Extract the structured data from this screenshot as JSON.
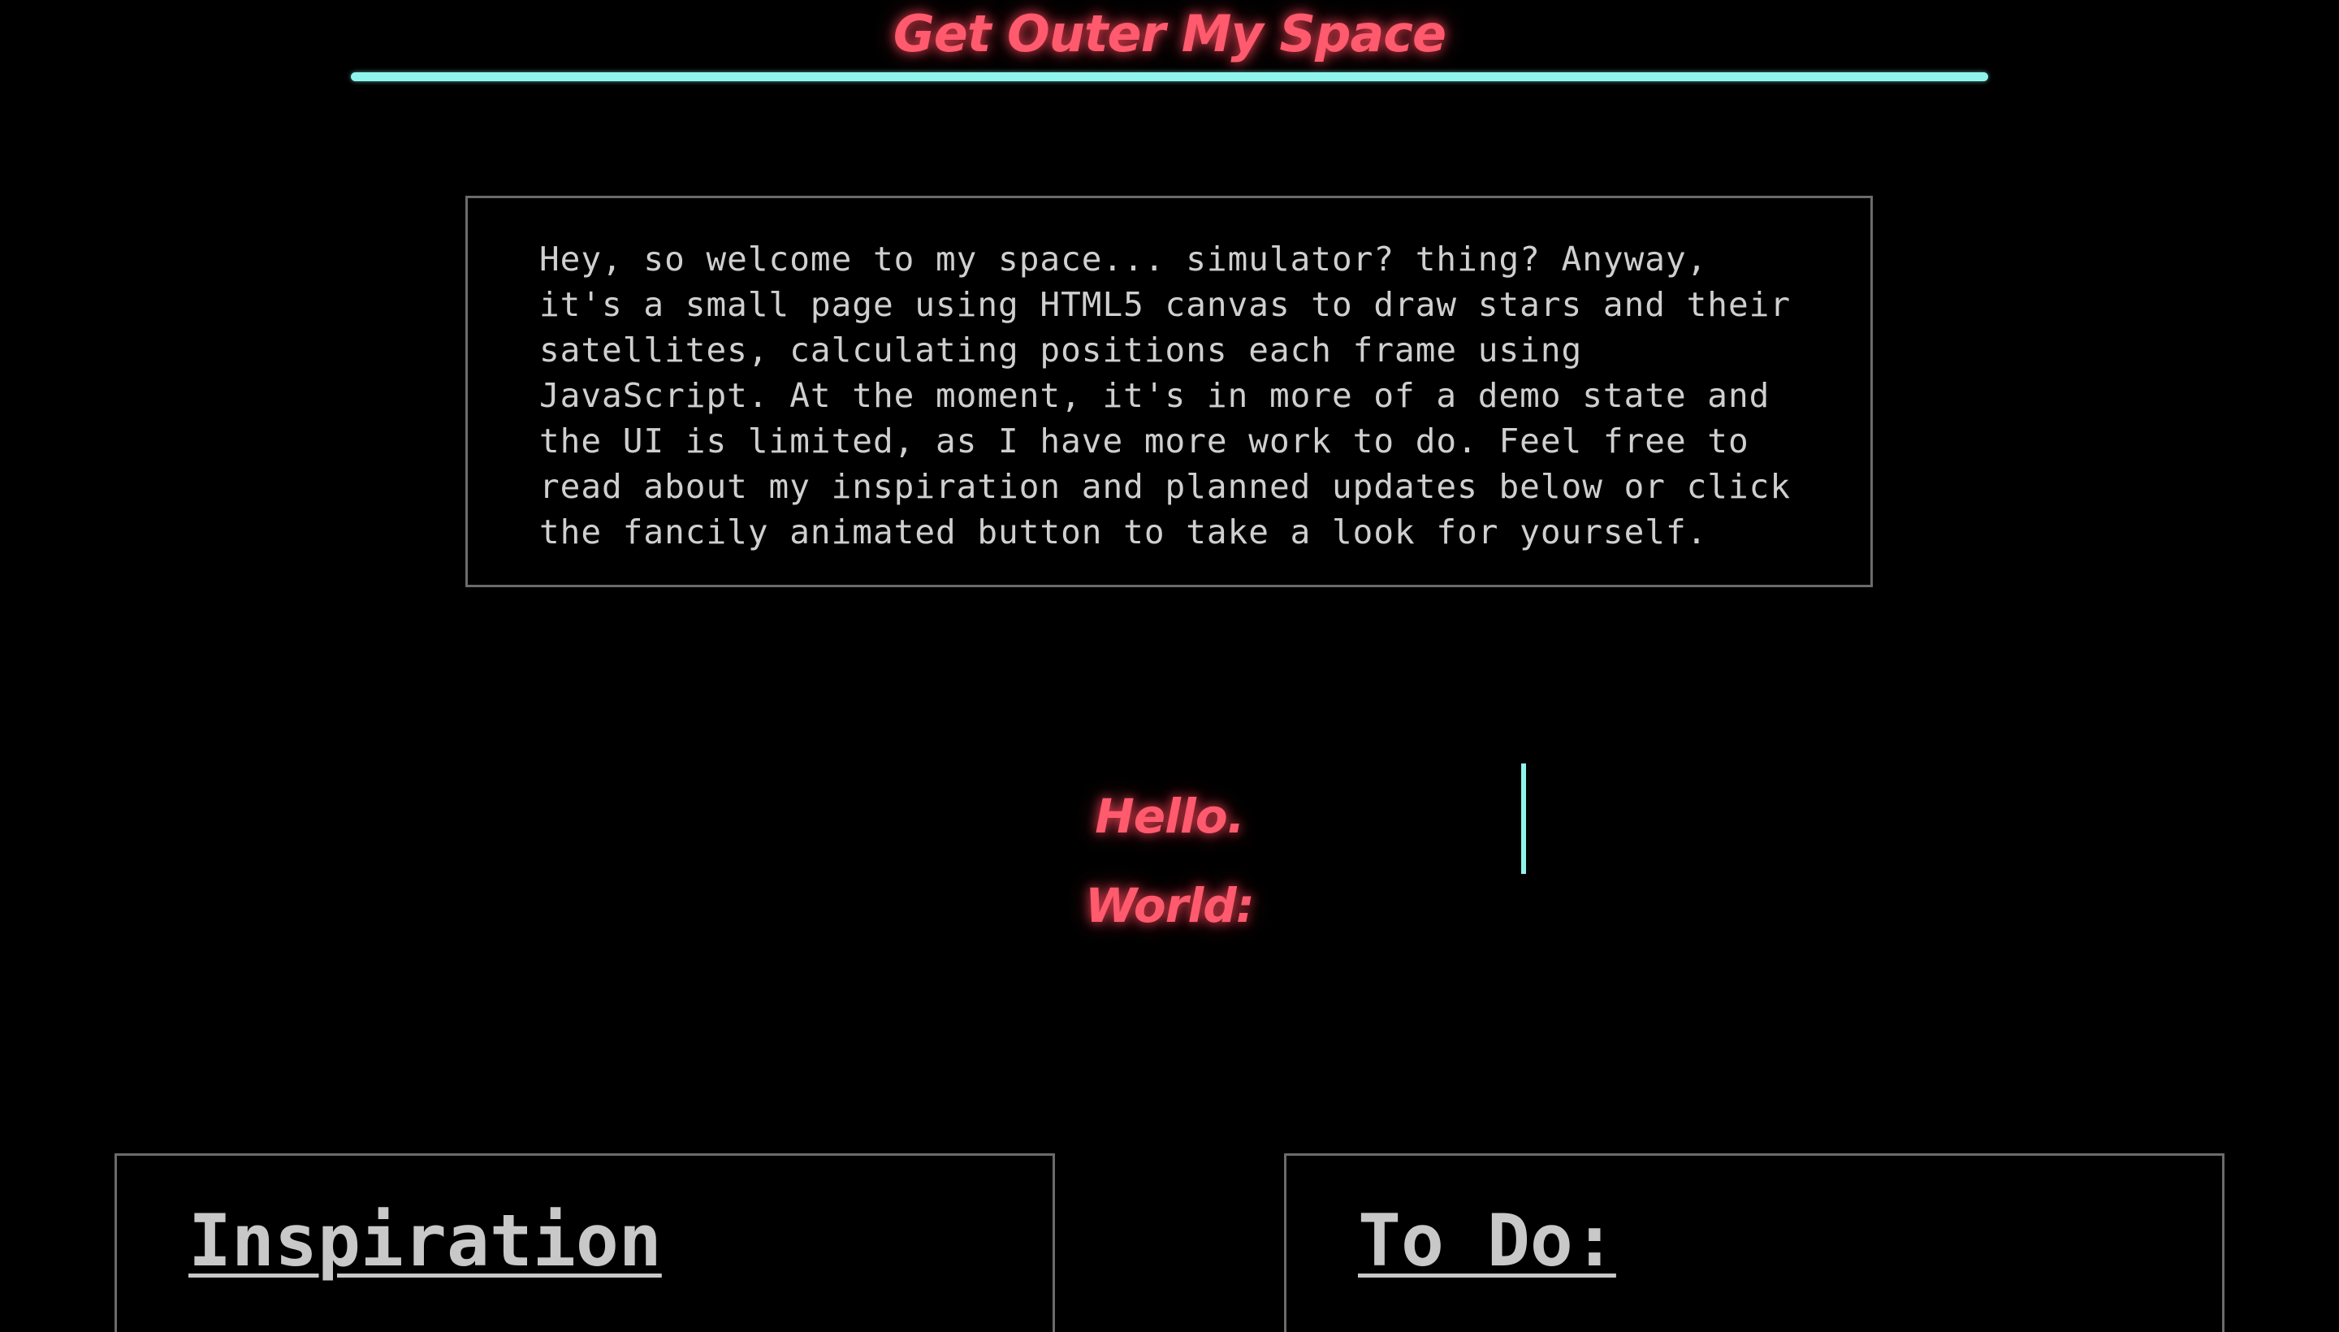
{
  "header": {
    "title": "Get Outer My Space"
  },
  "intro": {
    "text": "Hey, so welcome to my space... simulator? thing? Anyway,\nit's a small page using HTML5 canvas to draw stars and their\nsatellites, calculating positions each frame using\nJavaScript. At the moment, it's in more of a demo state and\nthe UI is limited, as I have more work to do. Feel free to\nread about my inspiration and planned updates below or click\nthe fancily animated button to take a look for yourself."
  },
  "launch": {
    "button_label": "Hello. World:"
  },
  "sections": {
    "inspiration": {
      "heading": "Inspiration"
    },
    "todo": {
      "heading": "To Do:"
    }
  },
  "colors": {
    "background": "#000000",
    "accent_pink": "#ff5a6e",
    "accent_cyan": "#8ff5ec",
    "text": "#cfcfcf",
    "border": "#6b6b6b"
  }
}
